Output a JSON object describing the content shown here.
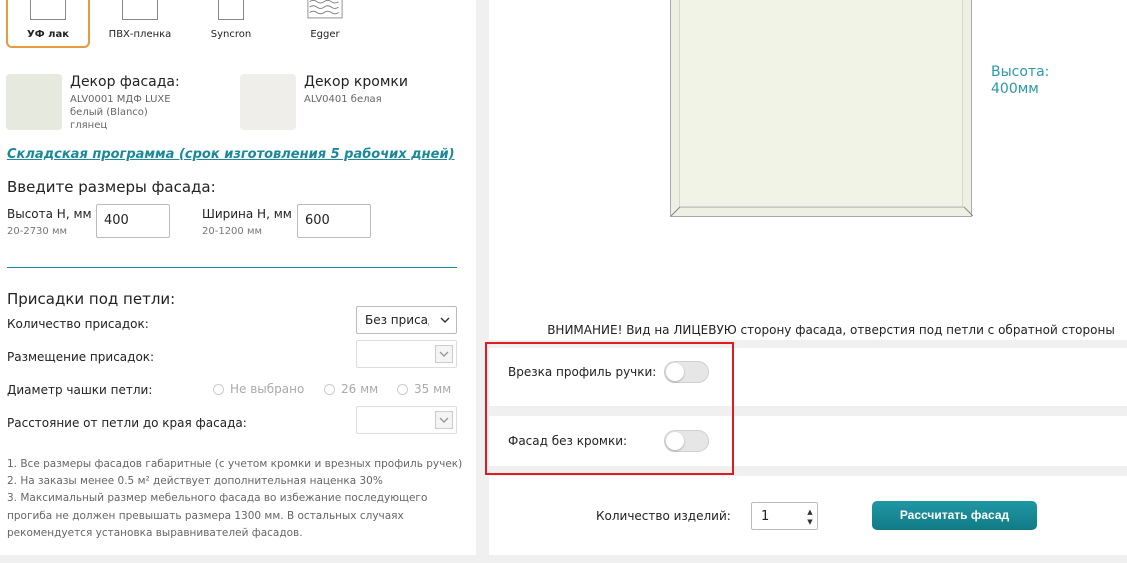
{
  "materials": [
    {
      "label": "УФ лак",
      "active": true
    },
    {
      "label": "ПВХ-пленка",
      "active": false
    },
    {
      "label": "Syncron",
      "active": false
    },
    {
      "label": "Egger",
      "active": false
    }
  ],
  "decor_facade": {
    "title": "Декор фасада:",
    "line1": "ALV0001 МДФ LUXE",
    "line2": "белый (Blanco)",
    "line3": "глянец",
    "swatch_color": "#e6e9dd"
  },
  "decor_edge": {
    "title": "Декор кромки",
    "line1": "ALV0401 белая",
    "swatch_color": "#f0eeea"
  },
  "warehouse_link": "Складская программа (срок изготовления 5 рабочих дней)",
  "sizes": {
    "title": "Введите размеры фасада:",
    "height_label": "Высота H, мм",
    "height_hint": "20-2730 мм",
    "height_value": "400",
    "width_label": "Ширина H, мм",
    "width_hint": "20-1200 мм",
    "width_value": "600"
  },
  "hinges": {
    "title": "Присадки под петли:",
    "count_label": "Количество присадок:",
    "count_value": "Без присадок",
    "placement_label": "Размещение присадок:",
    "cup_label": "Диаметр чашки петли:",
    "cup_options": [
      "Не выбрано",
      "26 мм",
      "35 мм"
    ],
    "distance_label": "Расстояние от петли до края фасада:"
  },
  "notes": [
    "1. Все размеры фасадов габаритные (с учетом кромки и врезных профиль ручек)",
    "2. На заказы менее 0.5 м² действует дополнительная наценка 30%",
    "3. Максимальный размер мебельного фасада во избежание последующего",
    "прогиба не должен превышать размера 1300 мм. В остальных случаях",
    "рекомендуется установка выравнивателей фасадов."
  ],
  "preview": {
    "height_label": "Высота:",
    "height_value": "400мм"
  },
  "warning": "ВНИМАНИЕ! Вид на ЛИЦЕВУЮ сторону фасада, отверстия под петли с обратной стороны",
  "options": {
    "handle_profile_label": "Врезка профиль ручки:",
    "handle_profile_on": false,
    "no_edge_label": "Фасад без кромки:",
    "no_edge_on": false
  },
  "order": {
    "qty_label": "Количество изделий:",
    "qty_value": "1",
    "calc_button": "Рассчитать фасад"
  },
  "colors": {
    "accent": "#1a8a99",
    "active_tile_border": "#e89a3c",
    "highlight": "#e01b22"
  }
}
